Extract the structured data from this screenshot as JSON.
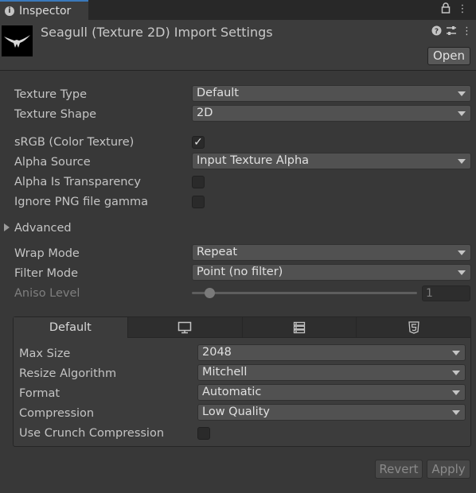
{
  "window": {
    "tab_label": "Inspector",
    "tab_icon": "info-icon"
  },
  "header": {
    "title": "Seagull (Texture 2D) Import Settings",
    "open_label": "Open",
    "icons": [
      "help-icon",
      "preset-icon",
      "more-icon"
    ]
  },
  "settings": {
    "texture_type": {
      "label": "Texture Type",
      "value": "Default"
    },
    "texture_shape": {
      "label": "Texture Shape",
      "value": "2D"
    },
    "srgb": {
      "label": "sRGB (Color Texture)",
      "checked": true,
      "check_glyph": "✓"
    },
    "alpha_source": {
      "label": "Alpha Source",
      "value": "Input Texture Alpha"
    },
    "alpha_is_transparency": {
      "label": "Alpha Is Transparency",
      "checked": false
    },
    "ignore_png_gamma": {
      "label": "Ignore PNG file gamma",
      "checked": false
    },
    "advanced": {
      "label": "Advanced",
      "expanded": false
    },
    "wrap_mode": {
      "label": "Wrap Mode",
      "value": "Repeat"
    },
    "filter_mode": {
      "label": "Filter Mode",
      "value": "Point (no filter)"
    },
    "aniso_level": {
      "label": "Aniso Level",
      "value": "1",
      "enabled": false
    }
  },
  "platform": {
    "tabs": [
      {
        "label": "Default",
        "icon": null,
        "active": true
      },
      {
        "label": "",
        "icon": "monitor-icon",
        "active": false
      },
      {
        "label": "",
        "icon": "server-icon",
        "active": false
      },
      {
        "label": "",
        "icon": "html5-icon",
        "active": false
      }
    ],
    "max_size": {
      "label": "Max Size",
      "value": "2048"
    },
    "resize_algorithm": {
      "label": "Resize Algorithm",
      "value": "Mitchell"
    },
    "format": {
      "label": "Format",
      "value": "Automatic"
    },
    "compression": {
      "label": "Compression",
      "value": "Low Quality"
    },
    "use_crunch": {
      "label": "Use Crunch Compression",
      "checked": false
    }
  },
  "footer": {
    "revert_label": "Revert",
    "apply_label": "Apply"
  }
}
